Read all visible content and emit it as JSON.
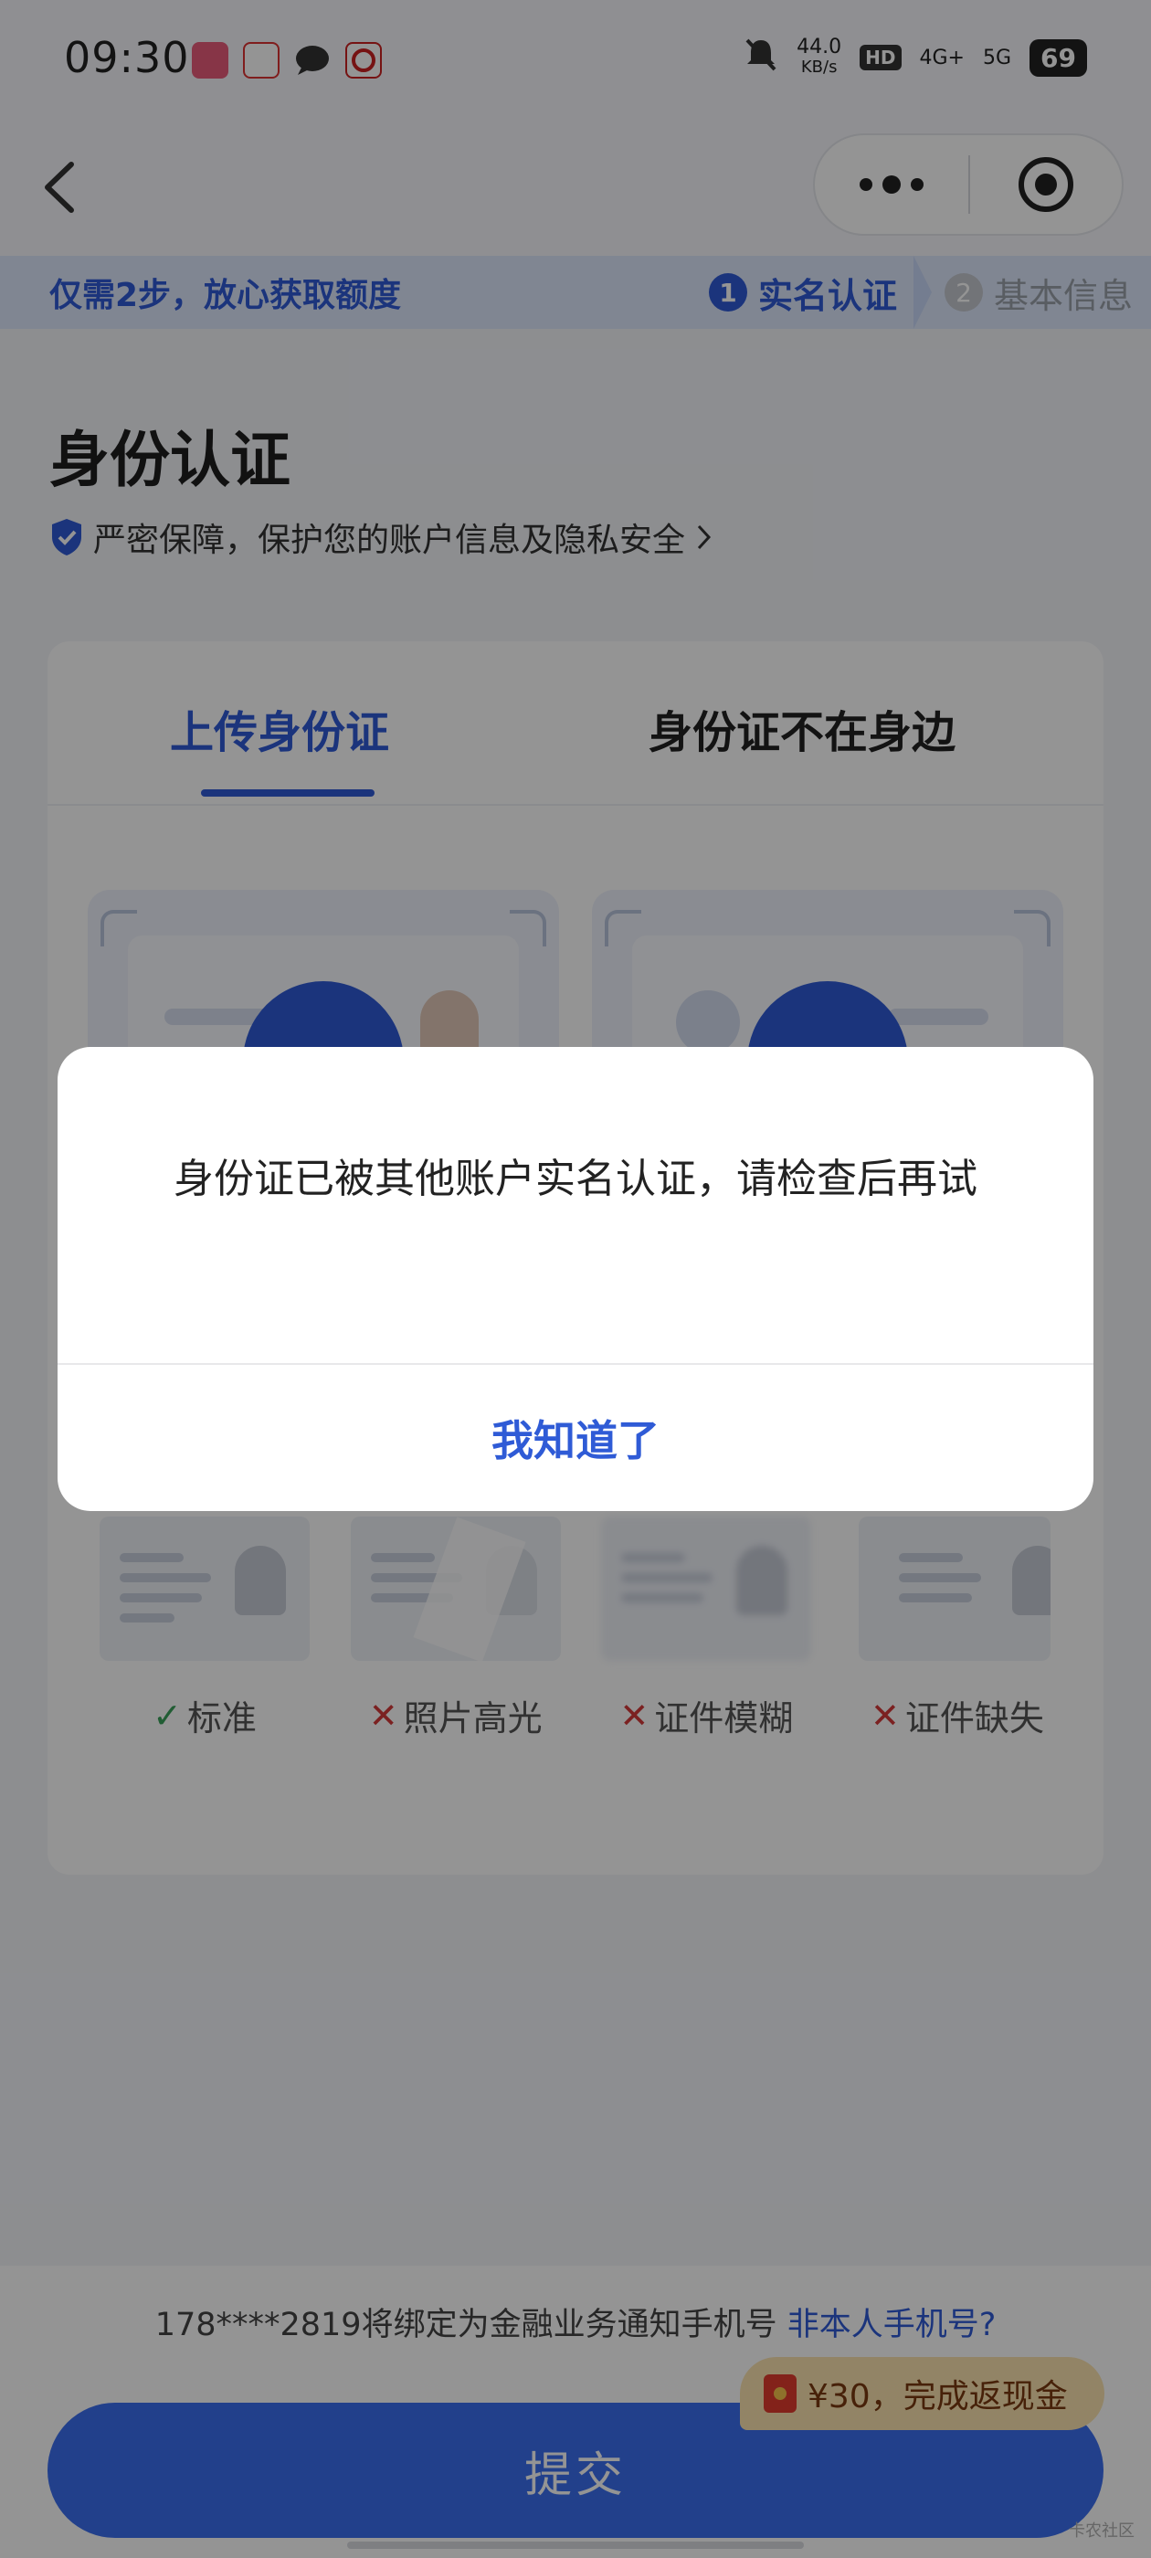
{
  "status_bar": {
    "time": "09:30",
    "net_speed": "44.0",
    "net_unit": "KB/s",
    "hd": "HD",
    "sig1": "4G+",
    "sig2": "5G",
    "battery": "69"
  },
  "step_banner": {
    "tip": "仅需2步，放心获取额度",
    "step1_num": "1",
    "step1_label": "实名认证",
    "step2_num": "2",
    "step2_label": "基本信息"
  },
  "page": {
    "title": "身份认证",
    "secure_note": "严密保障，保护您的账户信息及隐私安全"
  },
  "tabs": [
    {
      "label": "上传身份证",
      "active": true
    },
    {
      "label": "身份证不在身边",
      "active": false
    }
  ],
  "samples": [
    {
      "label": "标准",
      "ok": true
    },
    {
      "label": "照片高光",
      "ok": false
    },
    {
      "label": "证件模糊",
      "ok": false
    },
    {
      "label": "证件缺失",
      "ok": false
    }
  ],
  "bottom": {
    "phone_note": "178****2819将绑定为金融业务通知手机号",
    "phone_link": "非本人手机号?",
    "promo": "¥30，完成返现金",
    "submit": "提交"
  },
  "dialog": {
    "message": "身份证已被其他账户实名认证，请检查后再试",
    "button": "我知道了"
  },
  "watermark": "卡农社区",
  "colors": {
    "primary": "#2f5bd6",
    "submit": "#3b6ef0",
    "ok": "#3aa05a",
    "error": "#d53a3a"
  }
}
